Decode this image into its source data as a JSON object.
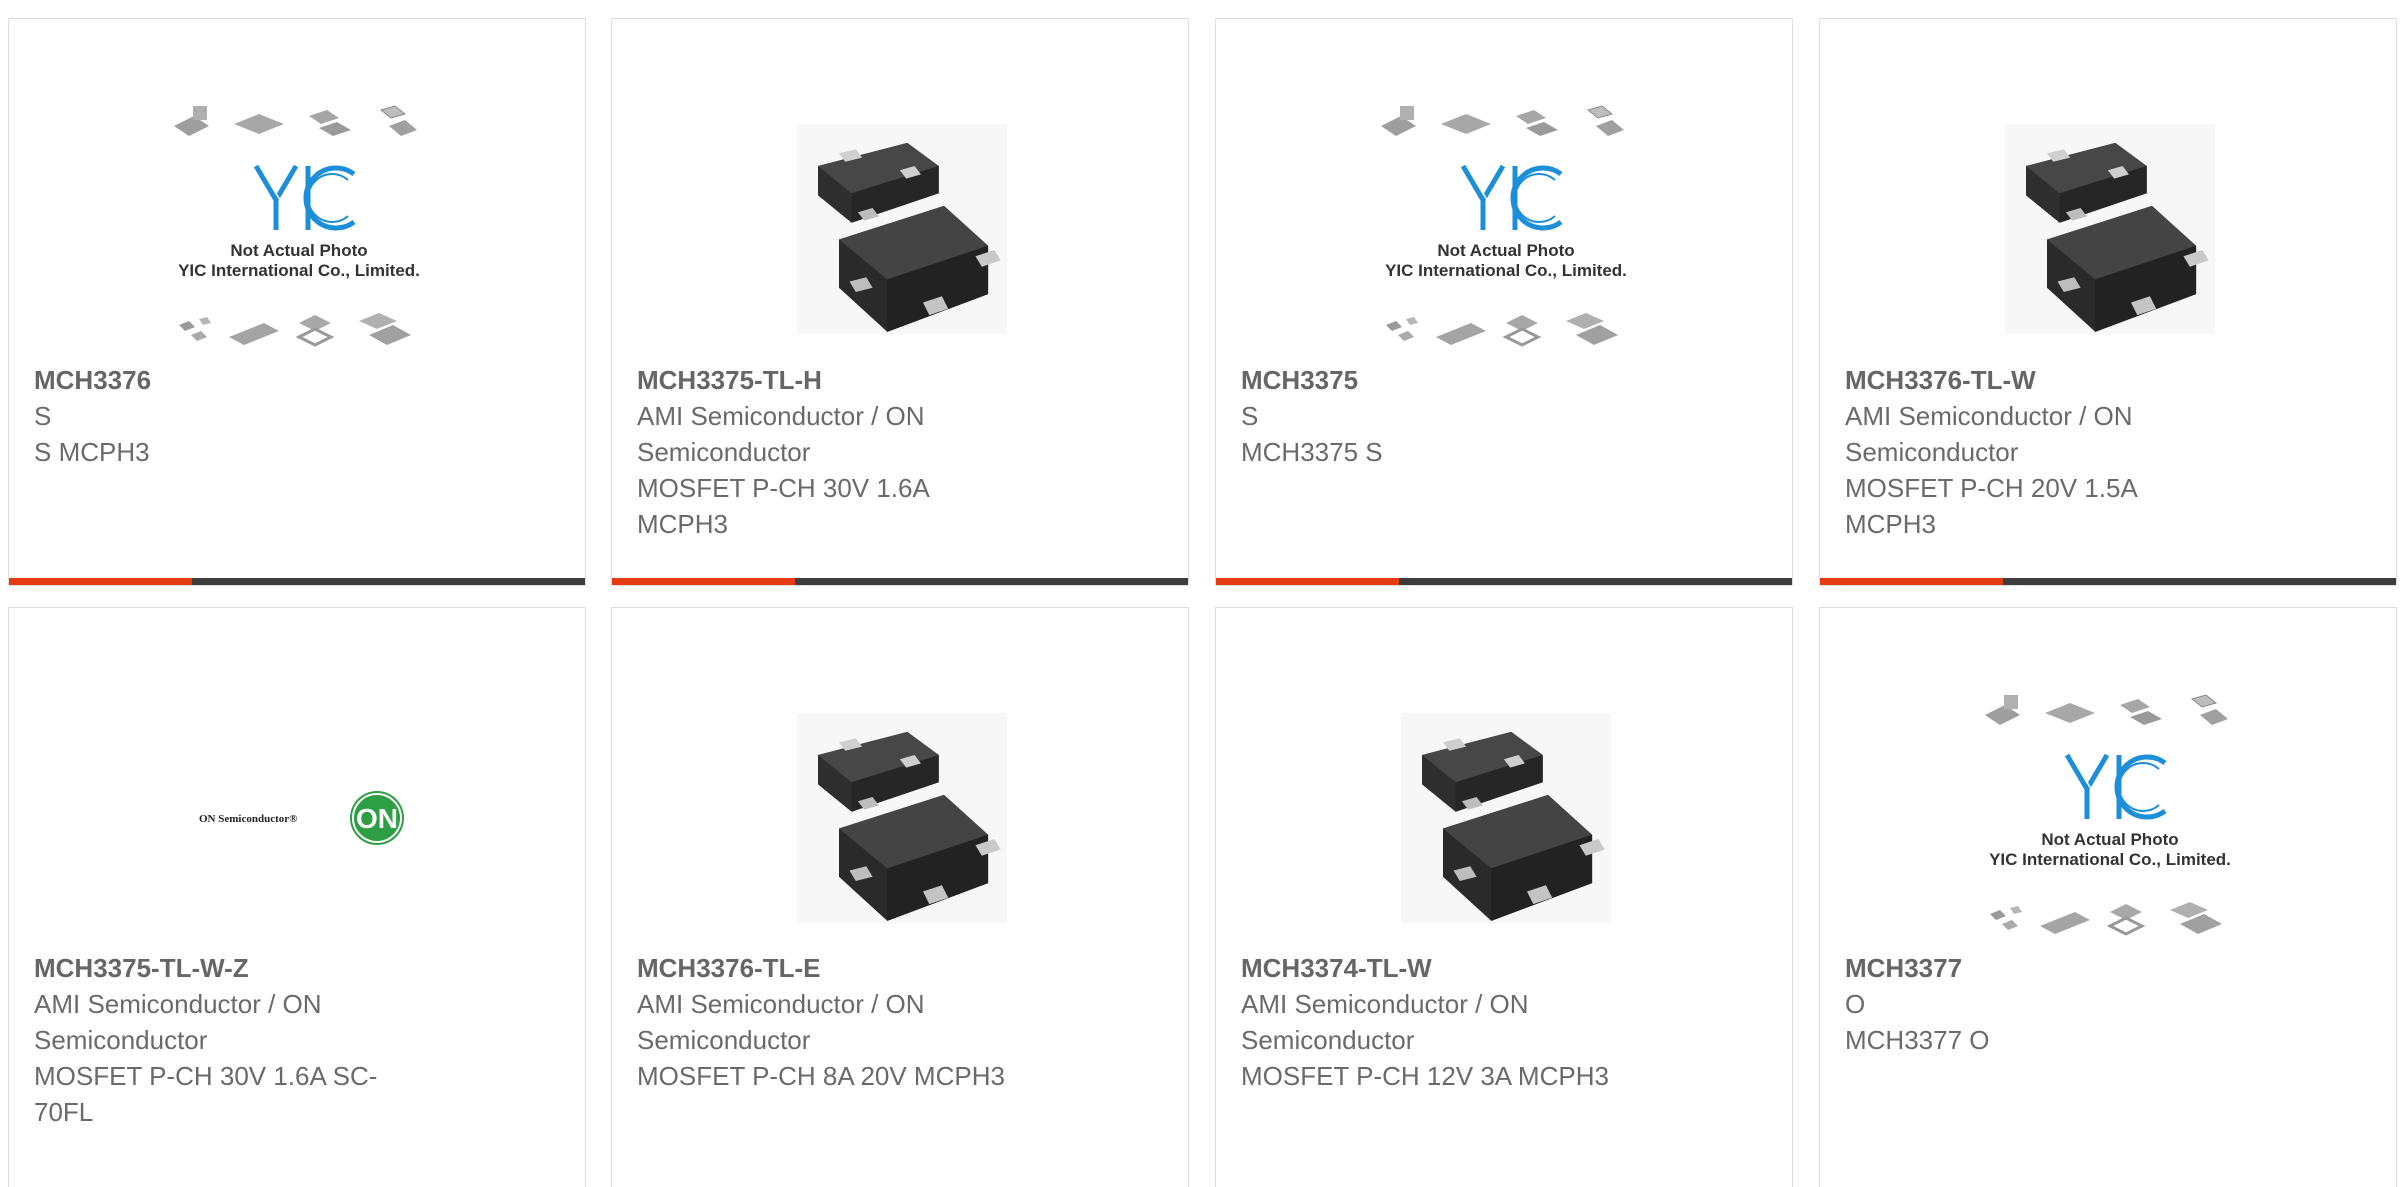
{
  "colors": {
    "accent": "#e63b12",
    "bar": "#3d3d3d",
    "text": "#6a6a6a",
    "border": "#dedede"
  },
  "placeholder": {
    "logo_text": "YIC",
    "line1": "Not Actual Photo",
    "line2": "YIC International Co., Limited."
  },
  "on_logo": {
    "brand": "ON Semiconductor®",
    "badge": "ON"
  },
  "products": [
    {
      "part": "MCH3376",
      "lines": [
        "S",
        "S MCPH3"
      ],
      "image": "placeholder-image"
    },
    {
      "part": "MCH3375-TL-H",
      "lines": [
        "AMI Semiconductor / ON",
        "Semiconductor",
        "MOSFET P-CH 30V 1.6A",
        "MCPH3"
      ],
      "image": "chip-photo"
    },
    {
      "part": "MCH3375",
      "lines": [
        "S",
        "MCH3375 S"
      ],
      "image": "placeholder-image"
    },
    {
      "part": "MCH3376-TL-W",
      "lines": [
        "AMI Semiconductor / ON",
        "Semiconductor",
        "MOSFET P-CH 20V 1.5A",
        "MCPH3"
      ],
      "image": "chip-photo"
    },
    {
      "part": "MCH3375-TL-W-Z",
      "lines": [
        "AMI Semiconductor / ON",
        "Semiconductor",
        "MOSFET P-CH 30V 1.6A SC-",
        "70FL"
      ],
      "image": "on-semiconductor-logo"
    },
    {
      "part": "MCH3376-TL-E",
      "lines": [
        "AMI Semiconductor / ON",
        "Semiconductor",
        "MOSFET P-CH 8A 20V MCPH3"
      ],
      "image": "chip-photo"
    },
    {
      "part": "MCH3374-TL-W",
      "lines": [
        "AMI Semiconductor / ON",
        "Semiconductor",
        "MOSFET P-CH 12V 3A MCPH3"
      ],
      "image": "chip-photo"
    },
    {
      "part": "MCH3377",
      "lines": [
        "O",
        "MCH3377 O"
      ],
      "image": "placeholder-image"
    }
  ]
}
